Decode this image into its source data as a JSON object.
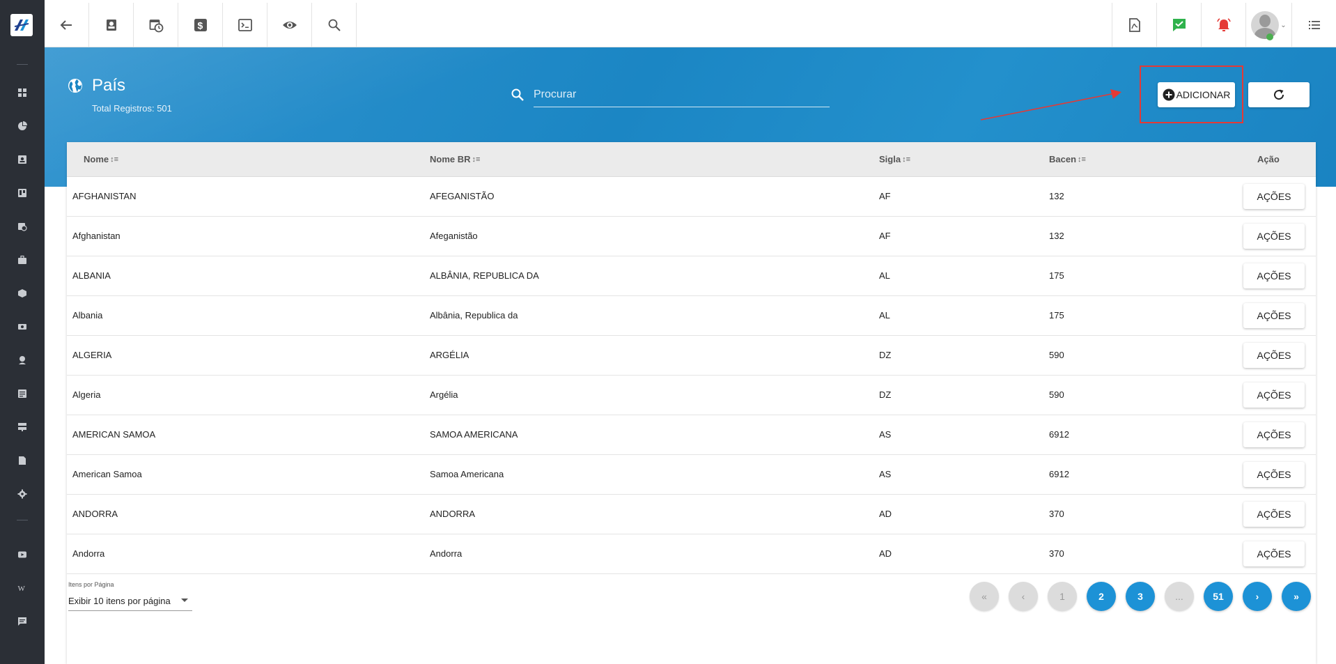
{
  "topbar": {
    "tools": [
      "back-icon",
      "contact-card-icon",
      "calendar-clock-icon",
      "dollar-icon",
      "terminal-icon",
      "eye-icon",
      "search-icon"
    ],
    "right_tools": [
      "pdf-icon",
      "check-message-icon",
      "alarm-bell-icon",
      "avatar",
      "menu-list-icon"
    ]
  },
  "sidebar": {
    "items": [
      "dashboard-icon",
      "pie-chart-icon",
      "contact-card-icon",
      "kanban-icon",
      "calendar-clock-icon",
      "briefcase-icon",
      "cube-icon",
      "money-icon",
      "location-person-icon",
      "document-list-icon",
      "server-icon",
      "file-icon",
      "gear-icon",
      "youtube-icon",
      "wikipedia-icon",
      "chat-icon"
    ]
  },
  "page": {
    "title": "País",
    "total_label": "Total Registros: 501"
  },
  "search": {
    "placeholder": "Procurar"
  },
  "actions": {
    "add_label": "ADICIONAR"
  },
  "colors": {
    "banner": "#1b86c4",
    "accent": "#1d92d6",
    "highlight": "#e53935",
    "sidebar": "#2b2f36"
  },
  "table": {
    "columns": [
      "Nome",
      "Nome BR",
      "Sigla",
      "Bacen",
      "Ação"
    ],
    "rows": [
      {
        "nome": "AFGHANISTAN",
        "nome_br": "AFEGANISTÃO",
        "sigla": "AF",
        "bacen": "132",
        "acao": "AÇÕES"
      },
      {
        "nome": "Afghanistan",
        "nome_br": "Afeganistão",
        "sigla": "AF",
        "bacen": "132",
        "acao": "AÇÕES"
      },
      {
        "nome": "ALBANIA",
        "nome_br": "ALBÂNIA, REPUBLICA DA",
        "sigla": "AL",
        "bacen": "175",
        "acao": "AÇÕES"
      },
      {
        "nome": "Albania",
        "nome_br": "Albânia, Republica da",
        "sigla": "AL",
        "bacen": "175",
        "acao": "AÇÕES"
      },
      {
        "nome": "ALGERIA",
        "nome_br": "ARGÉLIA",
        "sigla": "DZ",
        "bacen": "590",
        "acao": "AÇÕES"
      },
      {
        "nome": "Algeria",
        "nome_br": "Argélia",
        "sigla": "DZ",
        "bacen": "590",
        "acao": "AÇÕES"
      },
      {
        "nome": "AMERICAN SAMOA",
        "nome_br": "SAMOA AMERICANA",
        "sigla": "AS",
        "bacen": "6912",
        "acao": "AÇÕES"
      },
      {
        "nome": "American Samoa",
        "nome_br": "Samoa Americana",
        "sigla": "AS",
        "bacen": "6912",
        "acao": "AÇÕES"
      },
      {
        "nome": "ANDORRA",
        "nome_br": "ANDORRA",
        "sigla": "AD",
        "bacen": "370",
        "acao": "AÇÕES"
      },
      {
        "nome": "Andorra",
        "nome_br": "Andorra",
        "sigla": "AD",
        "bacen": "370",
        "acao": "AÇÕES"
      }
    ]
  },
  "pagination": {
    "items_label": "Itens por Página",
    "items_value": "Exibir 10 itens por página",
    "first": "«",
    "prev": "‹",
    "pages": [
      "1",
      "2",
      "3",
      "...",
      "51"
    ],
    "next": "›",
    "last": "»"
  }
}
